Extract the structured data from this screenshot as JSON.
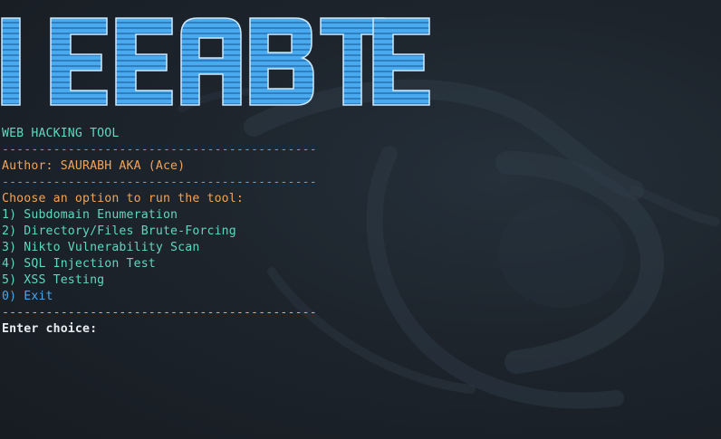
{
  "terminal": {
    "banner_text": "IEEABTE",
    "title": "WEB HACKING TOOL",
    "separator_blue": "-------------------------------------------",
    "author": "Author: SAURABH AKA (Ace)",
    "prompt_heading": "Choose an option to run the tool:",
    "menu": [
      {
        "label": "1) Subdomain Enumeration"
      },
      {
        "label": "2) Directory/Files Brute-Forcing"
      },
      {
        "label": "3) Nikto Vulnerability Scan"
      },
      {
        "label": "4) SQL Injection Test"
      },
      {
        "label": "5) XSS Testing"
      },
      {
        "label": "0) Exit"
      }
    ],
    "separator_orange": "-------------------------------------------",
    "input_prompt": "Enter choice:"
  },
  "colors": {
    "background": "#1c2128",
    "teal": "#5fd7c0",
    "blue": "#4aa6e8",
    "orange": "#f0a45a",
    "white": "#e8ecef",
    "banner_fill": "#4aaaf0"
  }
}
